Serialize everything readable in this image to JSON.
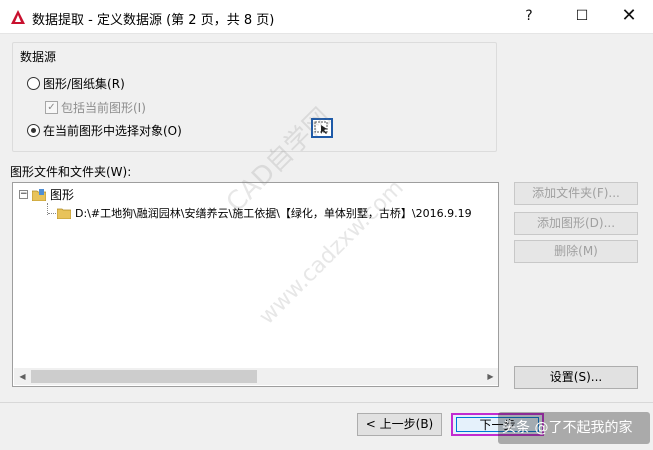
{
  "window": {
    "title": "数据提取 - 定义数据源 (第 2 页，共 8 页)",
    "help_label": "?",
    "maximize_label": "☐",
    "close_label": "✕"
  },
  "data_source": {
    "group_title": "数据源",
    "option_drawings": "图形/图纸集(R)",
    "option_include_current": "包括当前图形(I)",
    "option_select_objects": "在当前图形中选择对象(O)",
    "selected_option": "在当前图形中选择对象(O)"
  },
  "files": {
    "label": "图形文件和文件夹(W):",
    "root_label": "图形",
    "file_path": "D:\\#工地狗\\融润园林\\安缮养云\\施工依据\\【绿化，单体别墅，古桥】\\2016.9.19"
  },
  "side_buttons": {
    "add_folder": "添加文件夹(F)...",
    "add_drawing": "添加图形(D)...",
    "remove": "删除(M)",
    "settings": "设置(S)..."
  },
  "footer": {
    "back": "< 上一步(B)",
    "next": "下一步"
  },
  "watermarks": {
    "brand": "头条 @了不起我的家",
    "diagonal": "CAD自学网",
    "diagonal2": "www.cadzxw.com"
  },
  "colors": {
    "accent_blue": "#0078d7",
    "highlight_magenta": "#c22bd0",
    "autocad_red": "#c8102e"
  }
}
